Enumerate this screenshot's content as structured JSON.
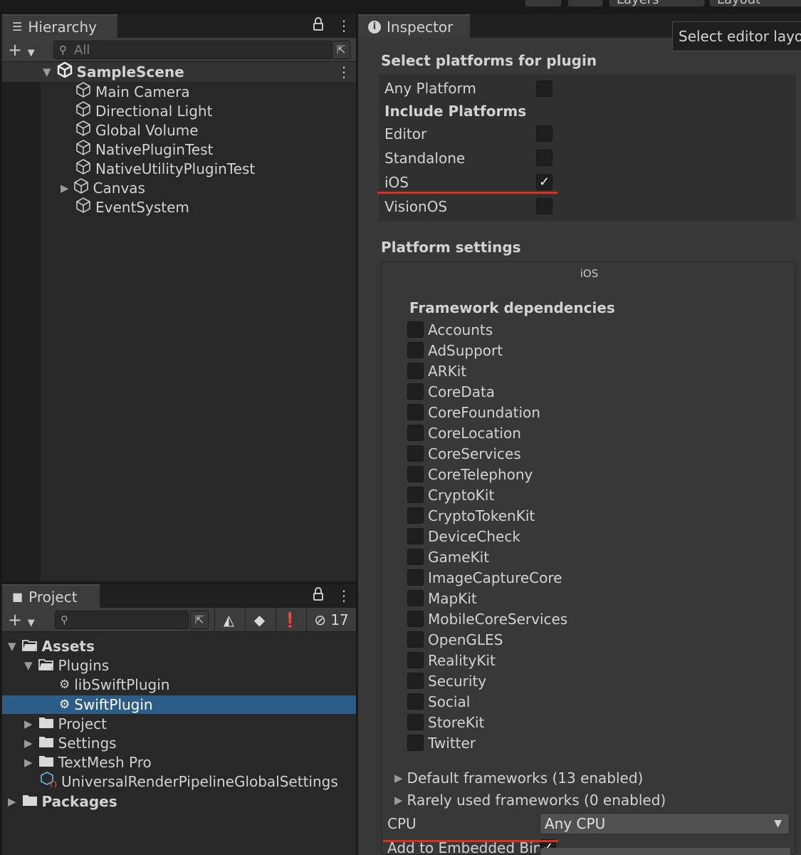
{
  "topbar": {
    "layers_label": "Layers",
    "layout_label": "Layout"
  },
  "hierarchy": {
    "tab_label": "Hierarchy",
    "search_placeholder": "All",
    "scene": "SampleScene",
    "items": [
      {
        "label": "Main Camera"
      },
      {
        "label": "Directional Light"
      },
      {
        "label": "Global Volume"
      },
      {
        "label": "NativePluginTest"
      },
      {
        "label": "NativeUtilityPluginTest"
      },
      {
        "label": "Canvas"
      },
      {
        "label": "EventSystem"
      }
    ]
  },
  "project": {
    "tab_label": "Project",
    "hidden_count": "17",
    "tree": [
      {
        "label": "Assets"
      },
      {
        "label": "Plugins"
      },
      {
        "label": "libSwiftPlugin"
      },
      {
        "label": "SwiftPlugin"
      },
      {
        "label": "Project"
      },
      {
        "label": "Settings"
      },
      {
        "label": "TextMesh Pro"
      },
      {
        "label": "UniversalRenderPipelineGlobalSettings"
      },
      {
        "label": "Packages"
      }
    ]
  },
  "inspector": {
    "tab_label": "Inspector",
    "tooltip": "Select editor layout",
    "select_platforms_heading": "Select platforms for plugin",
    "any_platform_label": "Any Platform",
    "include_platforms_label": "Include Platforms",
    "platforms": [
      {
        "label": "Editor",
        "checked": false
      },
      {
        "label": "Standalone",
        "checked": false
      },
      {
        "label": "iOS",
        "checked": true
      },
      {
        "label": "VisionOS",
        "checked": false
      }
    ],
    "platform_settings_heading": "Platform settings",
    "platform_tab": "iOS",
    "framework_heading": "Framework dependencies",
    "frameworks": [
      {
        "label": "Accounts"
      },
      {
        "label": "AdSupport"
      },
      {
        "label": "ARKit"
      },
      {
        "label": "CoreData"
      },
      {
        "label": "CoreFoundation"
      },
      {
        "label": "CoreLocation"
      },
      {
        "label": "CoreServices"
      },
      {
        "label": "CoreTelephony"
      },
      {
        "label": "CryptoKit"
      },
      {
        "label": "CryptoTokenKit"
      },
      {
        "label": "DeviceCheck"
      },
      {
        "label": "GameKit"
      },
      {
        "label": "ImageCaptureCore"
      },
      {
        "label": "MapKit"
      },
      {
        "label": "MobileCoreServices"
      },
      {
        "label": "OpenGLES"
      },
      {
        "label": "RealityKit"
      },
      {
        "label": "Security"
      },
      {
        "label": "Social"
      },
      {
        "label": "StoreKit"
      },
      {
        "label": "Twitter"
      }
    ],
    "default_frameworks_label": "Default frameworks (13 enabled)",
    "rarely_used_label": "Rarely used frameworks (0 enabled)",
    "cpu_label": "CPU",
    "cpu_value": "Any CPU",
    "embed_label": "Add to Embedded Bina",
    "embed_checked": true
  },
  "colors": {
    "selection": "#2c5d87",
    "highlight_underline": "#d9301f",
    "panel": "#383838"
  }
}
